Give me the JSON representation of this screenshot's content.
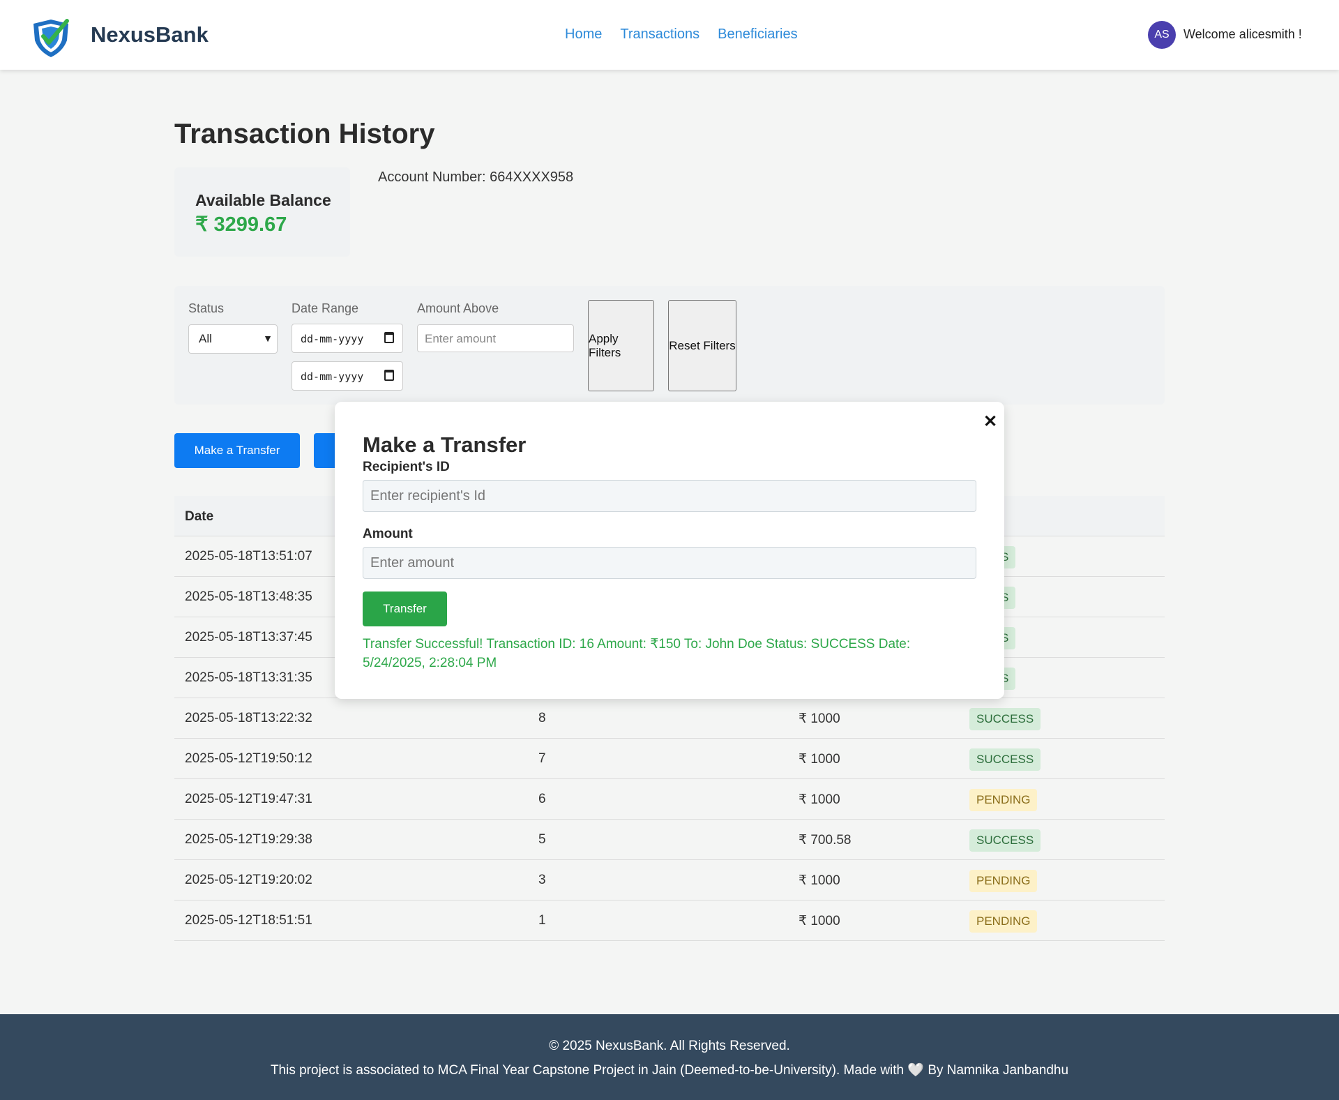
{
  "header": {
    "brand": "NexusBank",
    "nav": [
      "Home",
      "Transactions",
      "Beneficiaries"
    ],
    "avatar_initials": "AS",
    "welcome": "Welcome alicesmith !"
  },
  "main": {
    "title": "Transaction History",
    "balance_label": "Available Balance",
    "balance_value": "₹ 3299.67",
    "account_number": "Account Number: 664XXXX958"
  },
  "filters": {
    "status_label": "Status",
    "status_value": "All",
    "date_label": "Date Range",
    "date_placeholder": "dd-mm-yyyy",
    "amount_label": "Amount Above",
    "amount_placeholder": "Enter amount",
    "apply_label": "Apply Filters",
    "reset_label": "Reset Filters"
  },
  "actions": {
    "make_transfer_label": "Make a Transfer"
  },
  "table": {
    "headers": {
      "date": "Date",
      "status_partial": "s"
    },
    "rows": [
      {
        "date": "2025-05-18T13:51:07",
        "id": "",
        "amount": "",
        "status": "CESS",
        "kind": "success"
      },
      {
        "date": "2025-05-18T13:48:35",
        "id": "",
        "amount": "",
        "status": "CESS",
        "kind": "success"
      },
      {
        "date": "2025-05-18T13:37:45",
        "id": "",
        "amount": "",
        "status": "CESS",
        "kind": "success"
      },
      {
        "date": "2025-05-18T13:31:35",
        "id": "",
        "amount": "",
        "status": "CESS",
        "kind": "success"
      },
      {
        "date": "2025-05-18T13:22:32",
        "id": "8",
        "amount": "₹ 1000",
        "status": "SUCCESS",
        "kind": "success"
      },
      {
        "date": "2025-05-12T19:50:12",
        "id": "7",
        "amount": "₹ 1000",
        "status": "SUCCESS",
        "kind": "success"
      },
      {
        "date": "2025-05-12T19:47:31",
        "id": "6",
        "amount": "₹ 1000",
        "status": "PENDING",
        "kind": "pending"
      },
      {
        "date": "2025-05-12T19:29:38",
        "id": "5",
        "amount": "₹ 700.58",
        "status": "SUCCESS",
        "kind": "success"
      },
      {
        "date": "2025-05-12T19:20:02",
        "id": "3",
        "amount": "₹ 1000",
        "status": "PENDING",
        "kind": "pending"
      },
      {
        "date": "2025-05-12T18:51:51",
        "id": "1",
        "amount": "₹ 1000",
        "status": "PENDING",
        "kind": "pending"
      }
    ]
  },
  "modal": {
    "close_glyph": "✕",
    "title": "Make a Transfer",
    "recipient_label": "Recipient's ID",
    "recipient_placeholder": "Enter recipient's Id",
    "amount_label": "Amount",
    "amount_placeholder": "Enter amount",
    "transfer_label": "Transfer",
    "message": "Transfer Successful! Transaction ID: 16 Amount: ₹150 To: John Doe Status: SUCCESS Date: 5/24/2025, 2:28:04 PM"
  },
  "footer": {
    "line1": "© 2025 NexusBank. All Rights Reserved.",
    "line2": "This project is associated to MCA Final Year Capstone Project in Jain (Deemed-to-be-University). Made with 🤍 By Namnika Janbandhu"
  },
  "colors": {
    "accent_blue": "#0d7bf2",
    "success_green": "#2ea84a",
    "footer_bg": "#34495e",
    "avatar_bg": "#4a3fae"
  }
}
